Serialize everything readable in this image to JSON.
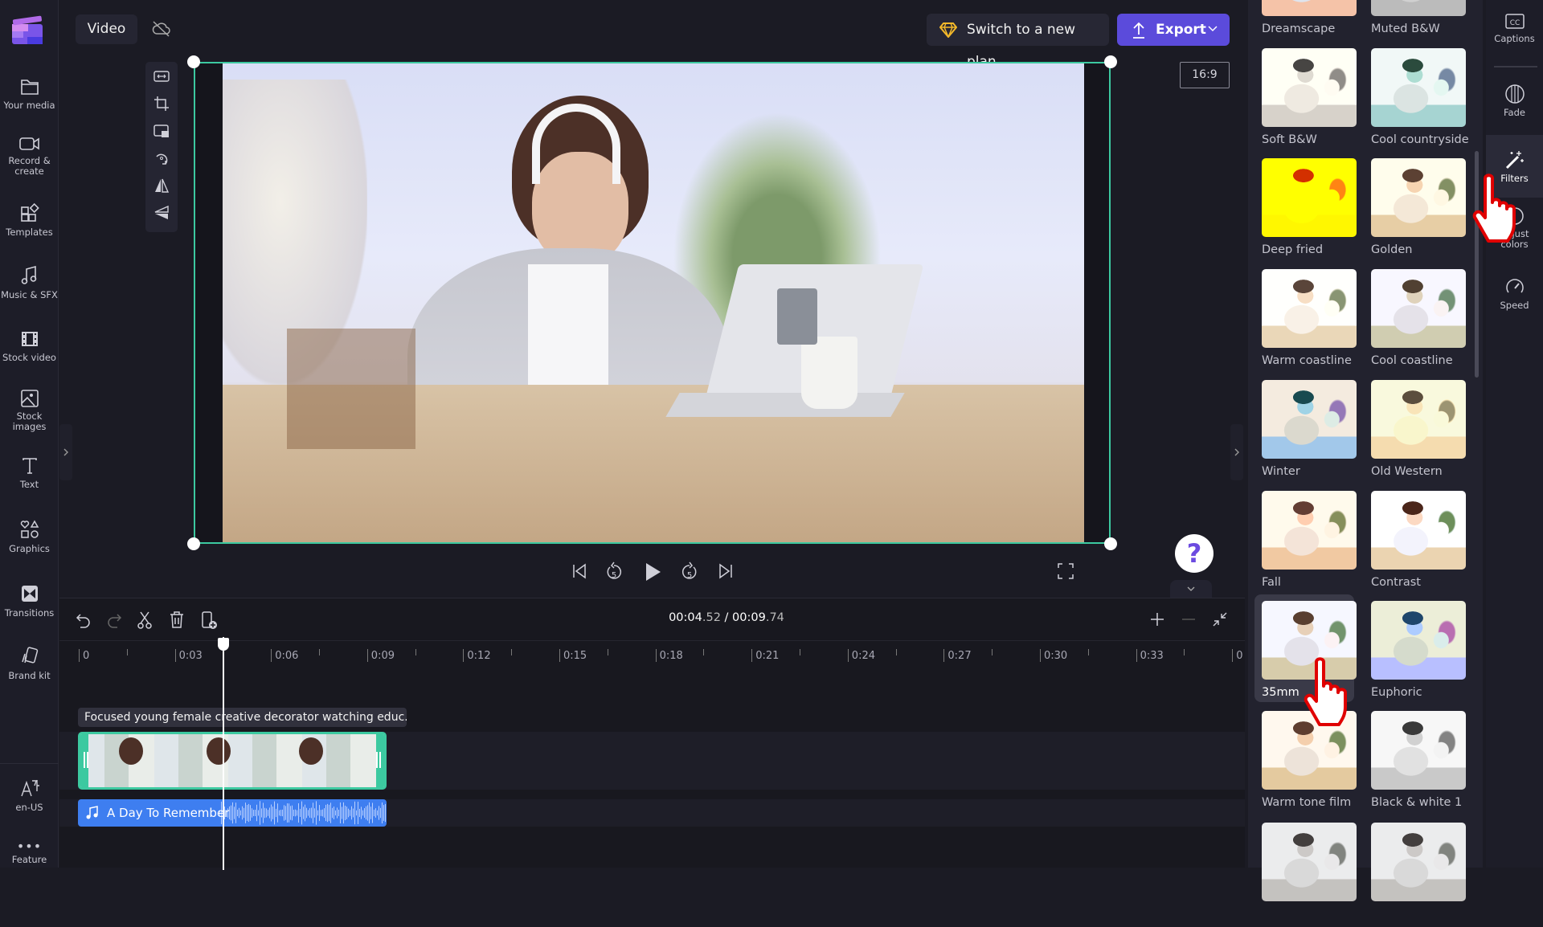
{
  "sidebar": {
    "items": [
      {
        "label": "Your media",
        "icon": "folder-icon"
      },
      {
        "label": "Record & create",
        "icon": "camera-icon"
      },
      {
        "label": "Templates",
        "icon": "templates-icon"
      },
      {
        "label": "Music & SFX",
        "icon": "music-icon"
      },
      {
        "label": "Stock video",
        "icon": "film-icon"
      },
      {
        "label": "Stock images",
        "icon": "image-icon"
      },
      {
        "label": "Text",
        "icon": "text-icon"
      },
      {
        "label": "Graphics",
        "icon": "shapes-icon"
      },
      {
        "label": "Transitions",
        "icon": "transition-icon"
      },
      {
        "label": "Brand kit",
        "icon": "brand-icon"
      }
    ],
    "language": "en-US",
    "feature": "Feature"
  },
  "header": {
    "project_tab": "Video",
    "plan_button": "Switch to a new plan",
    "export_button": "Export"
  },
  "preview": {
    "aspect_ratio": "16:9",
    "help": "?"
  },
  "timeline": {
    "current_time": "00:04",
    "current_frac": ".52",
    "separator": "/",
    "total_time": "00:09",
    "total_frac": ".74",
    "ruler_labels": [
      "0",
      "0:03",
      "0:06",
      "0:09",
      "0:12",
      "0:15",
      "0:18",
      "0:21",
      "0:24",
      "0:27",
      "0:30",
      "0:33",
      "0"
    ],
    "video_clip_label": "Focused young female creative decorator watching educ...",
    "audio_clip_label": "A Day To Remember",
    "playhead_seconds": 4.52
  },
  "filters": {
    "items": [
      {
        "label": "Dreamscape"
      },
      {
        "label": "Muted B&W"
      },
      {
        "label": "Soft B&W"
      },
      {
        "label": "Cool countryside"
      },
      {
        "label": "Deep fried"
      },
      {
        "label": "Golden"
      },
      {
        "label": "Warm coastline"
      },
      {
        "label": "Cool coastline"
      },
      {
        "label": "Winter"
      },
      {
        "label": "Old Western"
      },
      {
        "label": "Fall"
      },
      {
        "label": "Contrast"
      },
      {
        "label": "35mm",
        "selected": true
      },
      {
        "label": "Euphoric"
      },
      {
        "label": "Warm tone film"
      },
      {
        "label": "Black & white 1"
      },
      {
        "label": ""
      },
      {
        "label": ""
      }
    ]
  },
  "rail": {
    "items": [
      {
        "label": "Captions",
        "icon": "captions-icon"
      },
      {
        "label": "Fade",
        "icon": "fade-icon"
      },
      {
        "label": "Filters",
        "icon": "filters-icon",
        "selected": true
      },
      {
        "label": "Adjust colors",
        "icon": "adjust-colors-icon"
      },
      {
        "label": "Speed",
        "icon": "speed-icon"
      }
    ]
  },
  "colors": {
    "accent": "#5b4bdb",
    "selection": "#3cc9a0",
    "audio": "#3e7ef0",
    "cursor": "#e00000"
  }
}
